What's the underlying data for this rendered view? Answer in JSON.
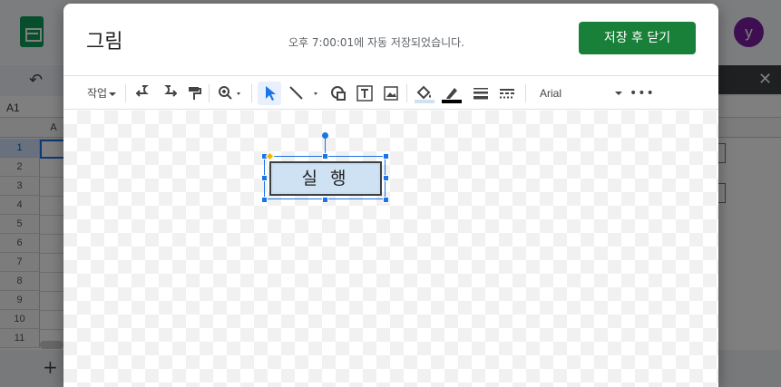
{
  "background": {
    "cell_ref": "A1",
    "column_header": "A",
    "rows": [
      "1",
      "2",
      "3",
      "4",
      "5",
      "6",
      "7",
      "8",
      "9",
      "10",
      "11"
    ],
    "avatar_letter": "y",
    "add_sheet": "+",
    "close_panel": "✕"
  },
  "dialog": {
    "title": "그림",
    "save_status": "오후 7:00:01에 자동 저장되었습니다.",
    "save_button": "저장 후 닫기"
  },
  "toolbar": {
    "actions_label": "작업",
    "font_name": "Arial",
    "more": "•••",
    "icons": [
      "undo-icon",
      "redo-icon",
      "paint-format-icon",
      "zoom-icon",
      "select-icon",
      "line-icon",
      "shape-icon",
      "text-box-icon",
      "image-icon",
      "fill-color-icon",
      "border-color-icon",
      "border-weight-icon",
      "border-dash-icon"
    ]
  },
  "canvas": {
    "shape_text": "실 행",
    "shape_fill": "#cfe2f3",
    "selection_color": "#1a73e8"
  },
  "colors": {
    "save_button": "#188038",
    "avatar": "#7b1fa2"
  }
}
